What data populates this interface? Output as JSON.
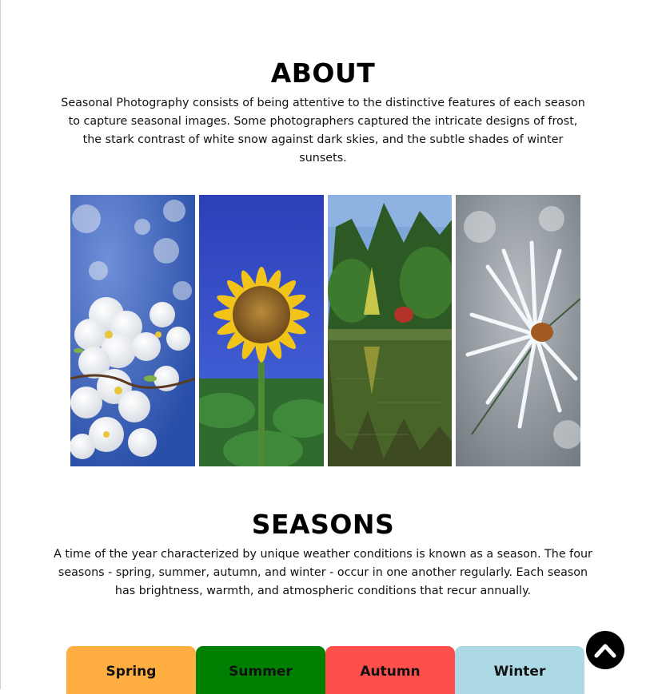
{
  "about": {
    "title": "ABOUT",
    "description": "Seasonal Photography consists of being attentive to the distinctive features of each season to capture seasonal images. Some photographers captured the intricate designs of frost, the stark contrast of white snow against dark skies, and the subtle shades of winter sunsets."
  },
  "gallery": {
    "photos": [
      {
        "subject": "spring-blossoms"
      },
      {
        "subject": "summer-sunflower"
      },
      {
        "subject": "autumn-lake"
      },
      {
        "subject": "winter-frost"
      }
    ]
  },
  "seasons": {
    "title": "SEASONS",
    "description": "A time of the year characterized by unique weather conditions is known as a season. The four seasons - spring, summer, autumn, and winter - occur in one another regularly. Each season has brightness, warmth, and atmospheric conditions that recur annually.",
    "tabs": [
      {
        "label": "Spring",
        "color": "#FFAE42"
      },
      {
        "label": "Summer",
        "color": "#008000"
      },
      {
        "label": "Autumn",
        "color": "#FF4F4B"
      },
      {
        "label": "Winter",
        "color": "#ADD8E6"
      }
    ]
  },
  "back_to_top": {
    "icon": "chevron-up-icon"
  }
}
